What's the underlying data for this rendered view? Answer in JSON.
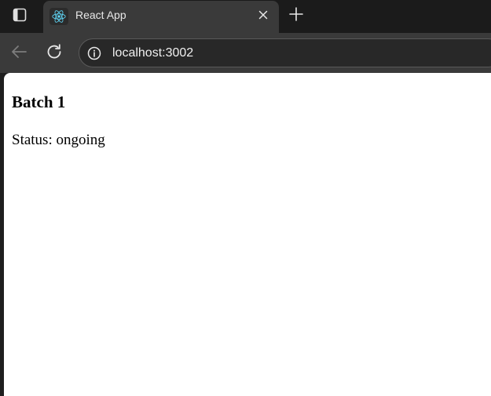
{
  "browser": {
    "tab": {
      "title": "React App",
      "favicon": "react-logo-icon"
    },
    "address_bar": {
      "url": "localhost:3002",
      "site_info_icon": "info-icon"
    },
    "icons": {
      "tab_actions": "tab-actions-icon",
      "close": "close-icon",
      "new_tab": "plus-icon",
      "back": "back-arrow-icon",
      "reload": "reload-icon"
    },
    "colors": {
      "tab_strip": "#1b1b1b",
      "toolbar": "#3a3a3a",
      "react_cyan": "#61dafb"
    }
  },
  "page": {
    "heading": "Batch 1",
    "status": "Status: ongoing"
  }
}
